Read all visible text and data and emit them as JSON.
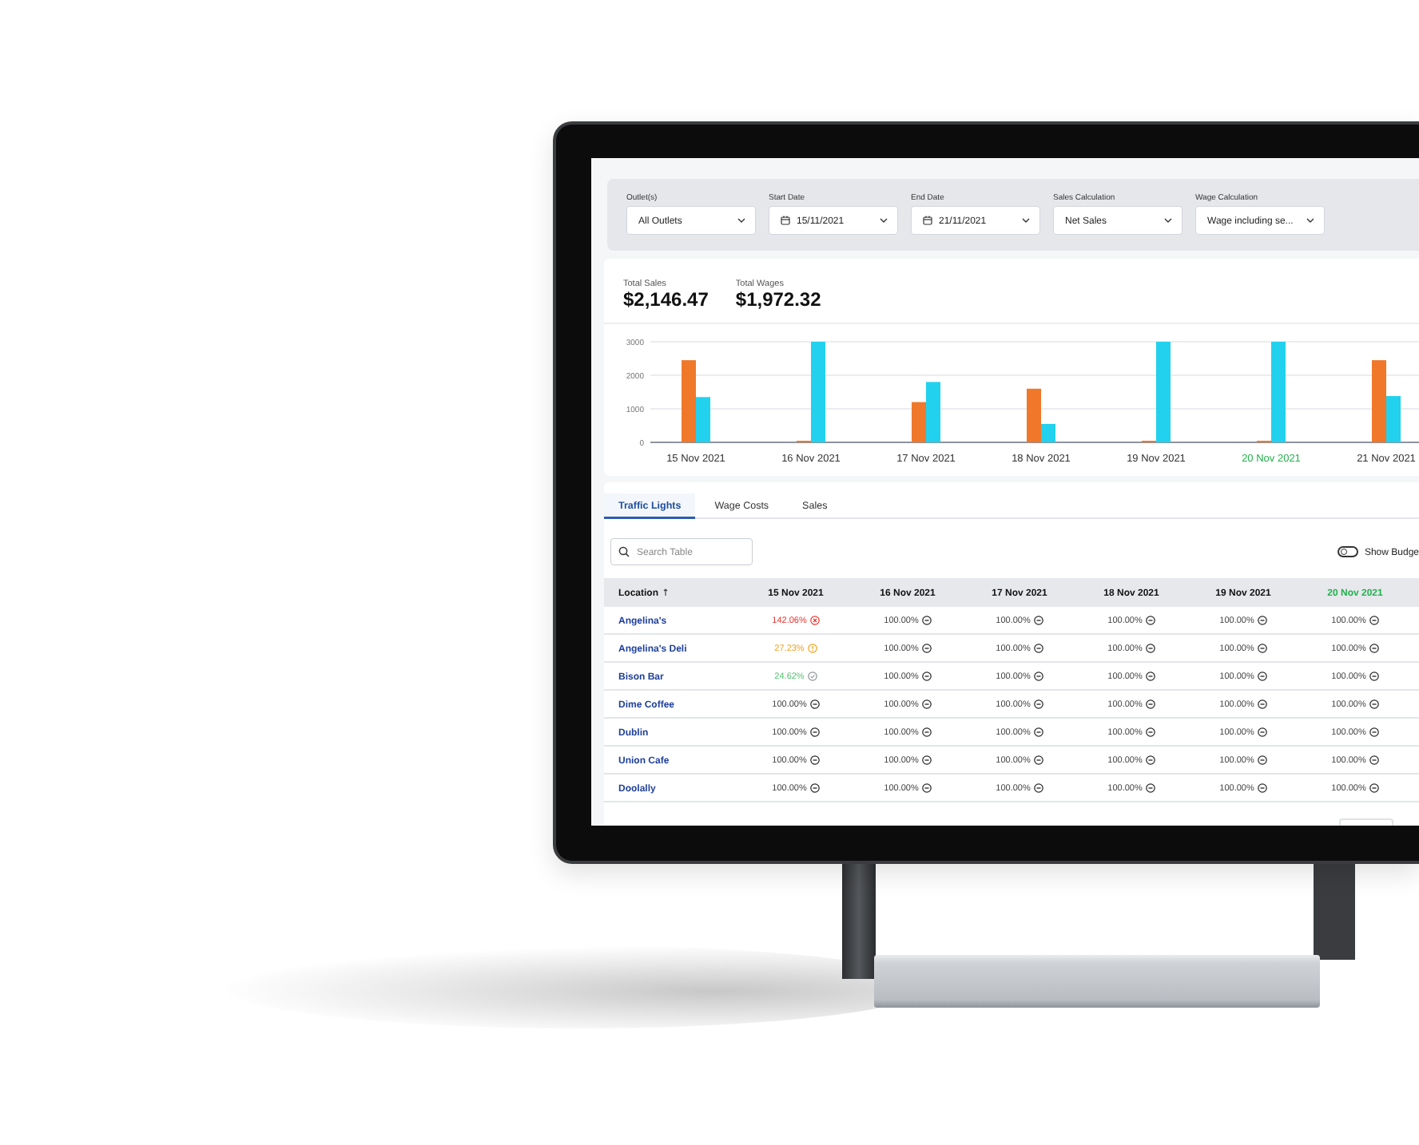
{
  "filters": [
    {
      "label": "Outlet(s)",
      "value": "All Outlets",
      "kind": "select"
    },
    {
      "label": "Start Date",
      "value": "15/11/2021",
      "kind": "date"
    },
    {
      "label": "End Date",
      "value": "21/11/2021",
      "kind": "date"
    },
    {
      "label": "Sales Calculation",
      "value": "Net Sales",
      "kind": "select"
    },
    {
      "label": "Wage Calculation",
      "value": "Wage including se...",
      "kind": "select"
    }
  ],
  "totals": [
    {
      "label": "Total Sales",
      "value": "$2,146.47"
    },
    {
      "label": "Total Wages",
      "value": "$1,972.32"
    }
  ],
  "chart": {
    "category_flags": [
      {
        "highlighted": false
      },
      {
        "highlighted": false
      },
      {
        "highlighted": false
      },
      {
        "highlighted": false
      },
      {
        "highlighted": false
      },
      {
        "highlighted": true
      },
      {
        "highlighted": false
      }
    ],
    "chart_data": {
      "type": "bar",
      "categories": [
        "15 Nov 2021",
        "16 Nov 2021",
        "17 Nov 2021",
        "18 Nov 2021",
        "19 Nov 2021",
        "20 Nov 2021",
        "21 Nov 2021"
      ],
      "series": [
        {
          "color": "#f0782a",
          "values": [
            2450,
            0,
            1200,
            1600,
            0,
            0,
            2450
          ]
        },
        {
          "color": "#22d1ee",
          "values": [
            1350,
            3000,
            1800,
            550,
            3000,
            3000,
            1380
          ]
        }
      ],
      "ylim": [
        0,
        3000
      ],
      "yticks": [
        0,
        1000,
        2000,
        3000
      ]
    }
  },
  "tabs": [
    {
      "label": "Traffic Lights",
      "selected": true
    },
    {
      "label": "Wage Costs",
      "selected": false
    },
    {
      "label": "Sales",
      "selected": false
    }
  ],
  "search": {
    "placeholder": "Search Table"
  },
  "budget_toggle": {
    "label": "Show Budge",
    "on": false
  },
  "table": {
    "columns": [
      {
        "label": "Location",
        "sorted": true,
        "highlighted": false
      },
      {
        "label": "15 Nov 2021",
        "sorted": false,
        "highlighted": false
      },
      {
        "label": "16 Nov 2021",
        "sorted": false,
        "highlighted": false
      },
      {
        "label": "17 Nov 2021",
        "sorted": false,
        "highlighted": false
      },
      {
        "label": "18 Nov 2021",
        "sorted": false,
        "highlighted": false
      },
      {
        "label": "19 Nov 2021",
        "sorted": false,
        "highlighted": false
      },
      {
        "label": "20 Nov 2021",
        "sorted": false,
        "highlighted": true
      }
    ],
    "rows": [
      {
        "cells": [
          {
            "value": "Angelina's",
            "kind": "location"
          },
          {
            "value": "142.06%",
            "kind": "over"
          },
          {
            "value": "100.00%",
            "kind": "neutral"
          },
          {
            "value": "100.00%",
            "kind": "neutral"
          },
          {
            "value": "100.00%",
            "kind": "neutral"
          },
          {
            "value": "100.00%",
            "kind": "neutral"
          },
          {
            "value": "100.00%",
            "kind": "neutral"
          }
        ]
      },
      {
        "cells": [
          {
            "value": "Angelina's Deli",
            "kind": "location"
          },
          {
            "value": "27.23%",
            "kind": "warning"
          },
          {
            "value": "100.00%",
            "kind": "neutral"
          },
          {
            "value": "100.00%",
            "kind": "neutral"
          },
          {
            "value": "100.00%",
            "kind": "neutral"
          },
          {
            "value": "100.00%",
            "kind": "neutral"
          },
          {
            "value": "100.00%",
            "kind": "neutral"
          }
        ]
      },
      {
        "cells": [
          {
            "value": "Bison Bar",
            "kind": "location"
          },
          {
            "value": "24.62%",
            "kind": "good"
          },
          {
            "value": "100.00%",
            "kind": "neutral"
          },
          {
            "value": "100.00%",
            "kind": "neutral"
          },
          {
            "value": "100.00%",
            "kind": "neutral"
          },
          {
            "value": "100.00%",
            "kind": "neutral"
          },
          {
            "value": "100.00%",
            "kind": "neutral"
          }
        ]
      },
      {
        "cells": [
          {
            "value": "Dime Coffee",
            "kind": "location"
          },
          {
            "value": "100.00%",
            "kind": "neutral"
          },
          {
            "value": "100.00%",
            "kind": "neutral"
          },
          {
            "value": "100.00%",
            "kind": "neutral"
          },
          {
            "value": "100.00%",
            "kind": "neutral"
          },
          {
            "value": "100.00%",
            "kind": "neutral"
          },
          {
            "value": "100.00%",
            "kind": "neutral"
          }
        ]
      },
      {
        "cells": [
          {
            "value": "Dublin",
            "kind": "location"
          },
          {
            "value": "100.00%",
            "kind": "neutral"
          },
          {
            "value": "100.00%",
            "kind": "neutral"
          },
          {
            "value": "100.00%",
            "kind": "neutral"
          },
          {
            "value": "100.00%",
            "kind": "neutral"
          },
          {
            "value": "100.00%",
            "kind": "neutral"
          },
          {
            "value": "100.00%",
            "kind": "neutral"
          }
        ]
      },
      {
        "cells": [
          {
            "value": "Union Cafe",
            "kind": "location"
          },
          {
            "value": "100.00%",
            "kind": "neutral"
          },
          {
            "value": "100.00%",
            "kind": "neutral"
          },
          {
            "value": "100.00%",
            "kind": "neutral"
          },
          {
            "value": "100.00%",
            "kind": "neutral"
          },
          {
            "value": "100.00%",
            "kind": "neutral"
          },
          {
            "value": "100.00%",
            "kind": "neutral"
          }
        ]
      },
      {
        "cells": [
          {
            "value": "Doolally",
            "kind": "location"
          },
          {
            "value": "100.00%",
            "kind": "neutral"
          },
          {
            "value": "100.00%",
            "kind": "neutral"
          },
          {
            "value": "100.00%",
            "kind": "neutral"
          },
          {
            "value": "100.00%",
            "kind": "neutral"
          },
          {
            "value": "100.00%",
            "kind": "neutral"
          },
          {
            "value": "100.00%",
            "kind": "neutral"
          }
        ]
      }
    ]
  }
}
